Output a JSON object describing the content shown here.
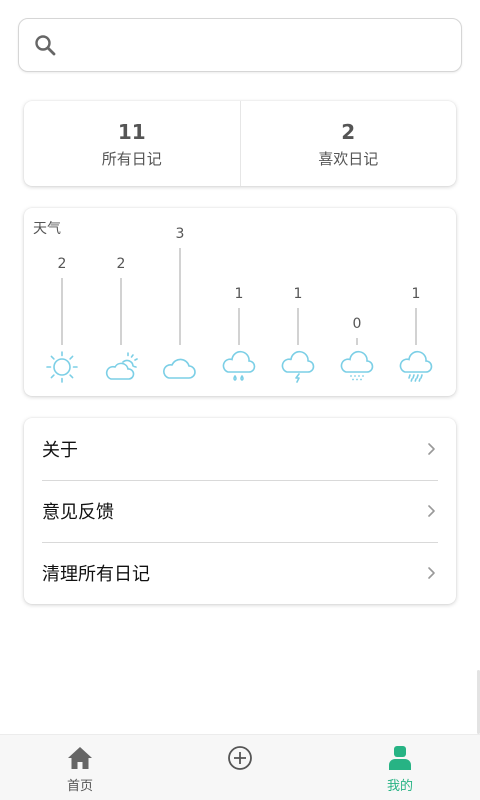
{
  "search": {
    "placeholder": "",
    "icon": "search-icon"
  },
  "stats": [
    {
      "value": "11",
      "label": "所有日记"
    },
    {
      "value": "2",
      "label": "喜欢日记"
    }
  ],
  "weather": {
    "title": "天气",
    "items": [
      {
        "icon": "sunny-icon",
        "count": "2"
      },
      {
        "icon": "partly-cloudy-icon",
        "count": "2"
      },
      {
        "icon": "cloudy-icon",
        "count": "3"
      },
      {
        "icon": "rain-icon",
        "count": "1"
      },
      {
        "icon": "thunderstorm-icon",
        "count": "1"
      },
      {
        "icon": "snow-icon",
        "count": "0"
      },
      {
        "icon": "heavy-rain-icon",
        "count": "1"
      }
    ]
  },
  "menu": [
    {
      "label": "关于"
    },
    {
      "label": "意见反馈"
    },
    {
      "label": "清理所有日记"
    }
  ],
  "nav": [
    {
      "label": "首页",
      "icon": "home-icon"
    },
    {
      "label": "",
      "icon": "add-circle-icon"
    },
    {
      "label": "我的",
      "icon": "profile-icon",
      "active": true
    }
  ],
  "colors": {
    "accent": "#27b384",
    "weather_icon": "#7ccfe6"
  }
}
